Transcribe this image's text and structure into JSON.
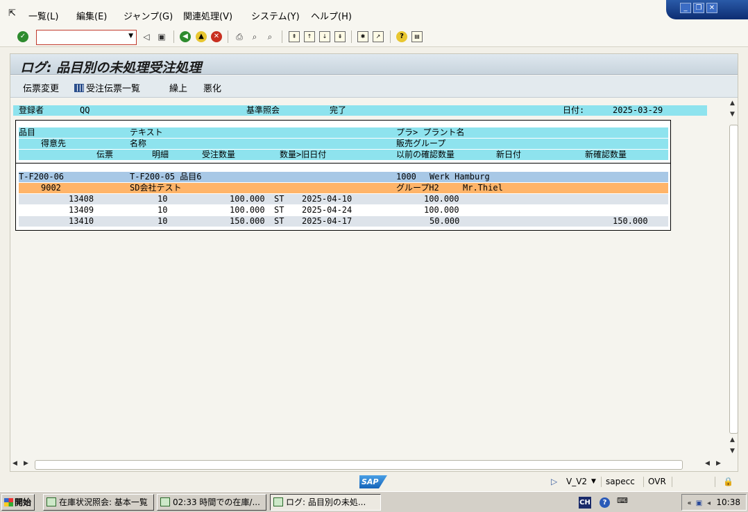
{
  "menu": {
    "items": [
      "一覧(L)",
      "編集(E)",
      "ジャンプ(G)",
      "関連処理(V)",
      "システム(Y)",
      "ヘルプ(H)"
    ]
  },
  "toolbar": {
    "command_value": ""
  },
  "title": "ログ: 品目別の未処理受注処理",
  "app_toolbar": {
    "change_document": "伝票変更",
    "order_list": "受注伝票一覧",
    "advance": "繰上",
    "worsen": "悪化"
  },
  "header_line": {
    "user_label": "登録者",
    "user_value": "QQ",
    "mode_label": "基準照会",
    "mode_value": "完了",
    "date_label": "日付:",
    "date_value": "2025-03-29"
  },
  "columns": {
    "row1": {
      "material": "品目",
      "text": "テキスト",
      "plant": "プラ> プラント名"
    },
    "row2": {
      "customer": "得意先",
      "name": "名称",
      "sales_group": "販売グループ"
    },
    "row3": {
      "document": "伝票",
      "item": "明細",
      "order_qty": "受注数量",
      "qty_old_date": "数量>旧日付",
      "prev_confirmed": "以前の確認数量",
      "new_date": "新日付",
      "new_confirmed": "新確認数量"
    }
  },
  "group": {
    "material": "T-F200-06",
    "material_text": "T-F200-05 品目6",
    "plant": "1000",
    "plant_name": "Werk Hamburg",
    "customer": "9002",
    "customer_name": "SD会社テスト",
    "sales_group": "グループH2",
    "contact": "Mr.Thiel"
  },
  "rows": [
    {
      "document": "13408",
      "item": "10",
      "qty": "100.000",
      "unit": "ST",
      "old_date": "2025-04-10",
      "prev_confirmed": "100.000",
      "new_date": "",
      "new_confirmed": ""
    },
    {
      "document": "13409",
      "item": "10",
      "qty": "100.000",
      "unit": "ST",
      "old_date": "2025-04-24",
      "prev_confirmed": "100.000",
      "new_date": "",
      "new_confirmed": ""
    },
    {
      "document": "13410",
      "item": "10",
      "qty": "150.000",
      "unit": "ST",
      "old_date": "2025-04-17",
      "prev_confirmed": "50.000",
      "new_date": "",
      "new_confirmed": "150.000"
    }
  ],
  "status_bar": {
    "logo": "SAP",
    "system": "V_V2",
    "server": "sapecc",
    "mode": "OVR"
  },
  "taskbar": {
    "start": "開始",
    "tasks": [
      "在庫状況照会: 基本一覧",
      "02:33 時間での在庫/...",
      "ログ: 品目別の未処..."
    ],
    "lang": "CH",
    "clock": "10:38"
  }
}
